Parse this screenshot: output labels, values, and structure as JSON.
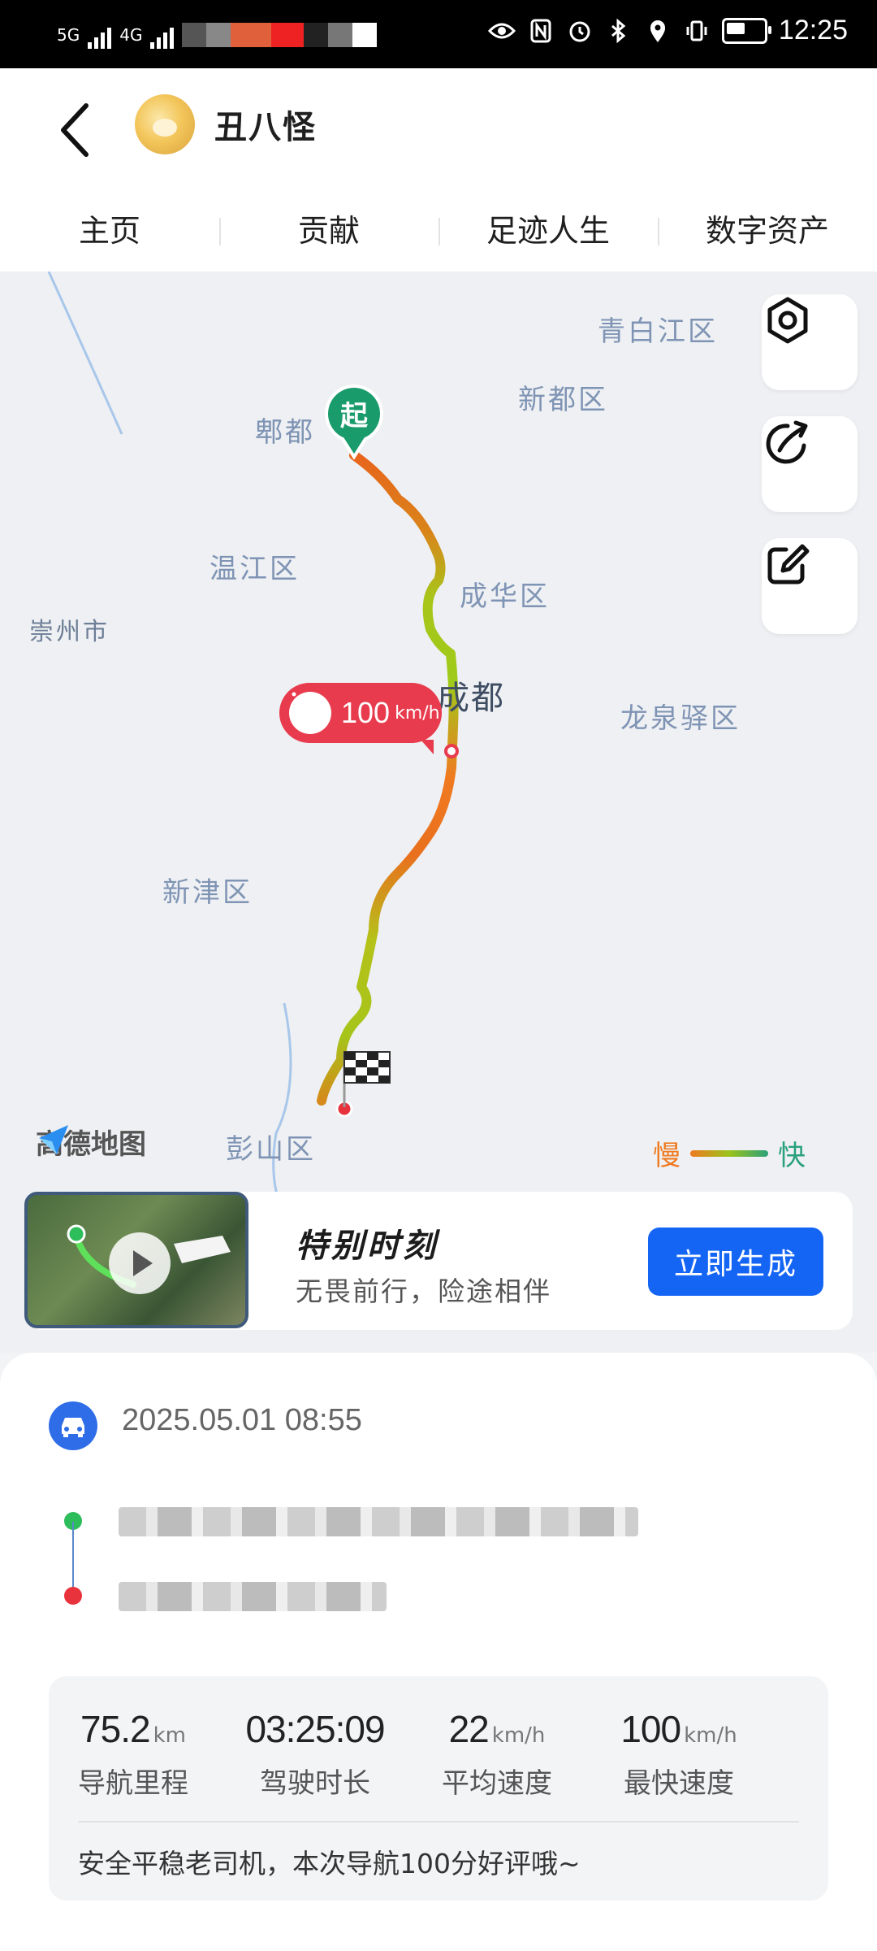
{
  "status_bar": {
    "time": "12:25",
    "network": "5G",
    "network2": "4G"
  },
  "header": {
    "username": "丑八怪"
  },
  "tabs": [
    {
      "label": "主页"
    },
    {
      "label": "贡献"
    },
    {
      "label": "足迹人生"
    },
    {
      "label": "数字资产"
    }
  ],
  "map": {
    "labels": {
      "qingbaijiang": "青白江区",
      "xindu": "新都区",
      "pidu": "郫都",
      "wenjiang": "温江区",
      "chenghua": "成华区",
      "chongzhou": "崇州市",
      "chengdu": "成都",
      "longquanyi": "龙泉驿区",
      "xinjin": "新津区",
      "pengshan": "彭山区"
    },
    "start_marker": "起",
    "max_speed_tag": {
      "value": "100",
      "unit": "km/h"
    },
    "logo": "高德地图",
    "legend": {
      "slow": "慢",
      "fast": "快"
    },
    "colors": {
      "slow": "#f07a20",
      "mid": "#9bc31a",
      "fast": "#2aa17a"
    }
  },
  "special_moment": {
    "title": "特别时刻",
    "subtitle": "无畏前行，险途相伴",
    "button": "立即生成"
  },
  "trip": {
    "datetime": "2025.05.01 08:55"
  },
  "stats": {
    "distance": {
      "value": "75.2",
      "unit": "km",
      "label": "导航里程"
    },
    "duration": {
      "value": "03:25:09",
      "unit": "",
      "label": "驾驶时长"
    },
    "avg_speed": {
      "value": "22",
      "unit": "km/h",
      "label": "平均速度"
    },
    "max_speed": {
      "value": "100",
      "unit": "km/h",
      "label": "最快速度"
    },
    "comment": "安全平稳老司机，本次导航100分好评哦~"
  }
}
